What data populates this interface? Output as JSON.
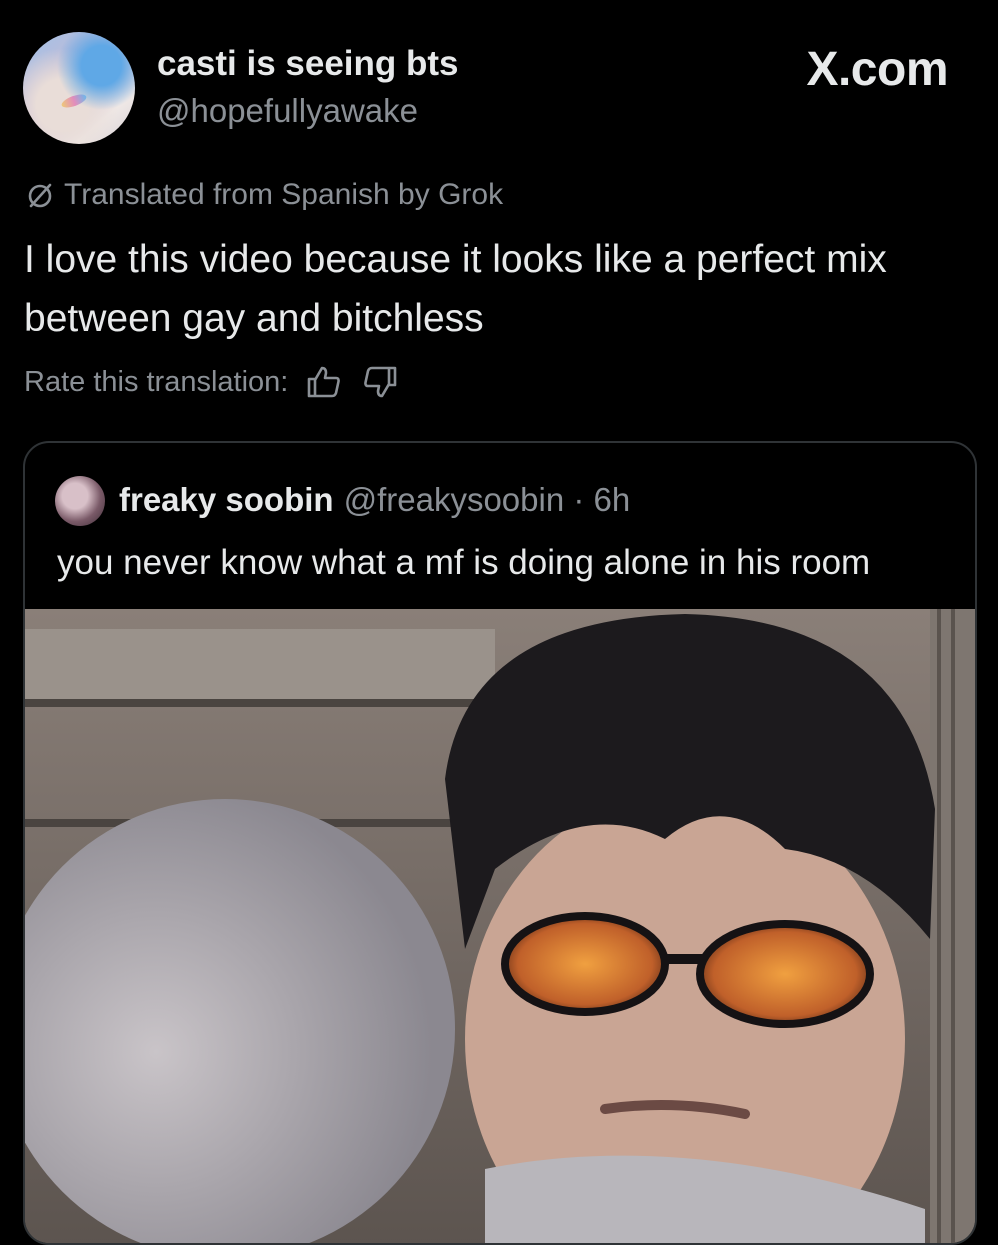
{
  "post": {
    "display_name": "casti is seeing bts",
    "handle": "@hopefullyawake",
    "brand": "X.com",
    "translated_label": "Translated from Spanish by Grok",
    "text": "I love this video because it looks like a perfect mix between gay and bitchless",
    "rate_label": "Rate this translation:"
  },
  "quoted": {
    "display_name": "freaky soobin",
    "handle_time": "@freakysoobin · 6h",
    "text": "you never know what a mf is doing alone in his room"
  },
  "icons": {
    "translate": "translate-slash-icon",
    "thumbs_up": "thumbs-up-icon",
    "thumbs_down": "thumbs-down-icon"
  },
  "colors": {
    "background": "#000000",
    "text_primary": "#e7e9ea",
    "text_secondary": "#8b9096",
    "border": "#2f3336"
  }
}
